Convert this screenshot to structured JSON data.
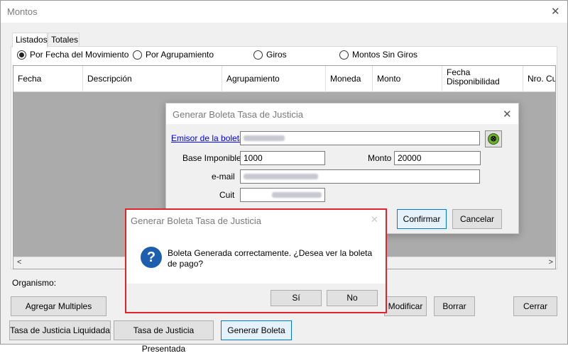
{
  "window": {
    "title": "Montos",
    "close": "✕"
  },
  "tabs": [
    "Listados",
    "Totales"
  ],
  "radios": [
    {
      "label": "Por Fecha del Movimiento",
      "selected": true
    },
    {
      "label": "Por Agrupamiento",
      "selected": false
    },
    {
      "label": "Giros",
      "selected": false
    },
    {
      "label": "Montos Sin Giros",
      "selected": false
    }
  ],
  "grid": {
    "columns": [
      "Fecha",
      "Descripción",
      "Agrupamiento",
      "Moneda",
      "Monto",
      "Fecha Disponibilidad",
      "Nro. Cue"
    ],
    "scroll_left": "<",
    "scroll_right": ">"
  },
  "organismo_label": "Organismo:",
  "buttons": {
    "agregar_multiples": "Agregar Multiples",
    "modificar": "Modificar",
    "borrar": "Borrar",
    "cerrar": "Cerrar",
    "tasa_liquidada": "Tasa de Justicia Liquidada",
    "tasa_presentada": "Tasa de Justicia Presentada",
    "generar_boleta": "Generar Boleta"
  },
  "dialog_boleta": {
    "title": "Generar Boleta Tasa de Justicia",
    "close": "✕",
    "emisor_link": "Emisor de la boleta",
    "base_imponible_label": "Base Imponible",
    "base_imponible_value": "1000",
    "monto_label": "Monto",
    "monto_value": "20000",
    "email_label": "e-mail",
    "cuit_label": "Cuit",
    "confirmar": "Confirmar",
    "cancelar": "Cancelar",
    "search_icon": "binoculars-icon"
  },
  "dialog_confirm": {
    "title": "Generar Boleta Tasa de Justicia",
    "close": "✕",
    "icon": "question-icon",
    "message": "Boleta Generada correctamente. ¿Desea ver la boleta de pago?",
    "yes": "Sí",
    "no": "No"
  },
  "colors": {
    "highlight_border": "#e0242c",
    "link": "#0000ee",
    "focus": "#0078d7"
  }
}
